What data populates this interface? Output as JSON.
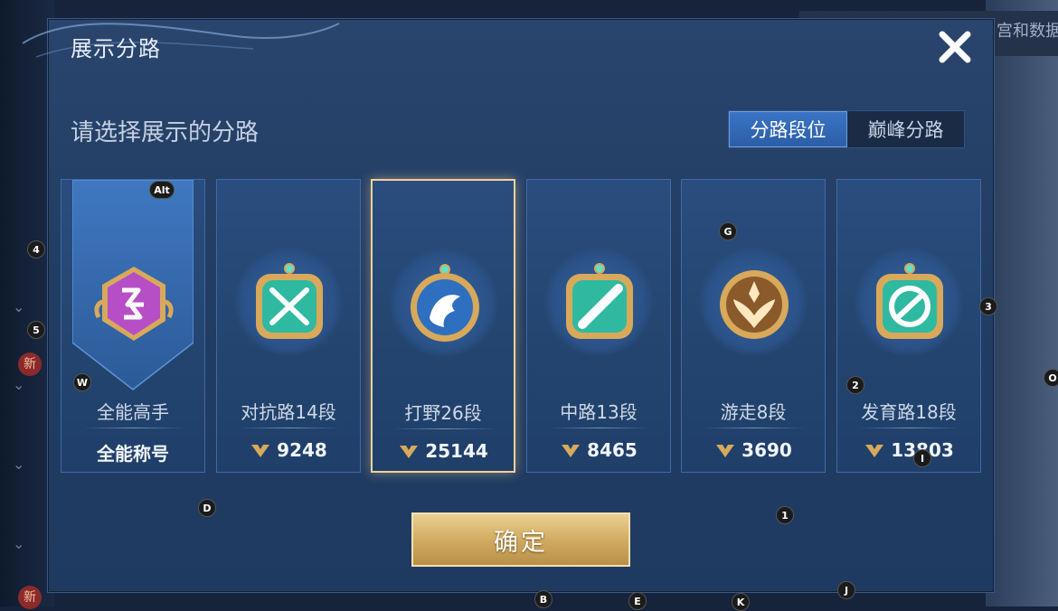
{
  "dialog": {
    "title": "展示分路",
    "subtitle": "请选择展示的分路",
    "tabs": [
      {
        "label": "分路段位",
        "active": true
      },
      {
        "label": "巅峰分路",
        "active": false
      }
    ],
    "confirm_label": "确定"
  },
  "background": {
    "top_right_text": "宫和数据",
    "new_badge": "新"
  },
  "cards": [
    {
      "name": "全能高手",
      "value": "全能称号",
      "icon": "purple-emblem-icon",
      "selected": false
    },
    {
      "name": "对抗路14段",
      "value": "9248",
      "icon": "crossed-swords-badge-icon",
      "selected": false
    },
    {
      "name": "打野26段",
      "value": "25144",
      "icon": "dragon-badge-icon",
      "selected": true
    },
    {
      "name": "中路13段",
      "value": "8465",
      "icon": "diagonal-slash-badge-icon",
      "selected": false
    },
    {
      "name": "游走8段",
      "value": "3690",
      "icon": "winged-shield-badge-icon",
      "selected": false
    },
    {
      "name": "发育路18段",
      "value": "13803",
      "icon": "chain-link-badge-icon",
      "selected": false
    }
  ],
  "hints": [
    "Alt",
    "4",
    "5",
    "W",
    "D",
    "G",
    "3",
    "2",
    "I",
    "1",
    "O",
    "B",
    "E",
    "K",
    "J"
  ],
  "colors": {
    "accent_blue": "#3a74c6",
    "gold": "#d2ac62",
    "teal": "#2fb9a1"
  }
}
